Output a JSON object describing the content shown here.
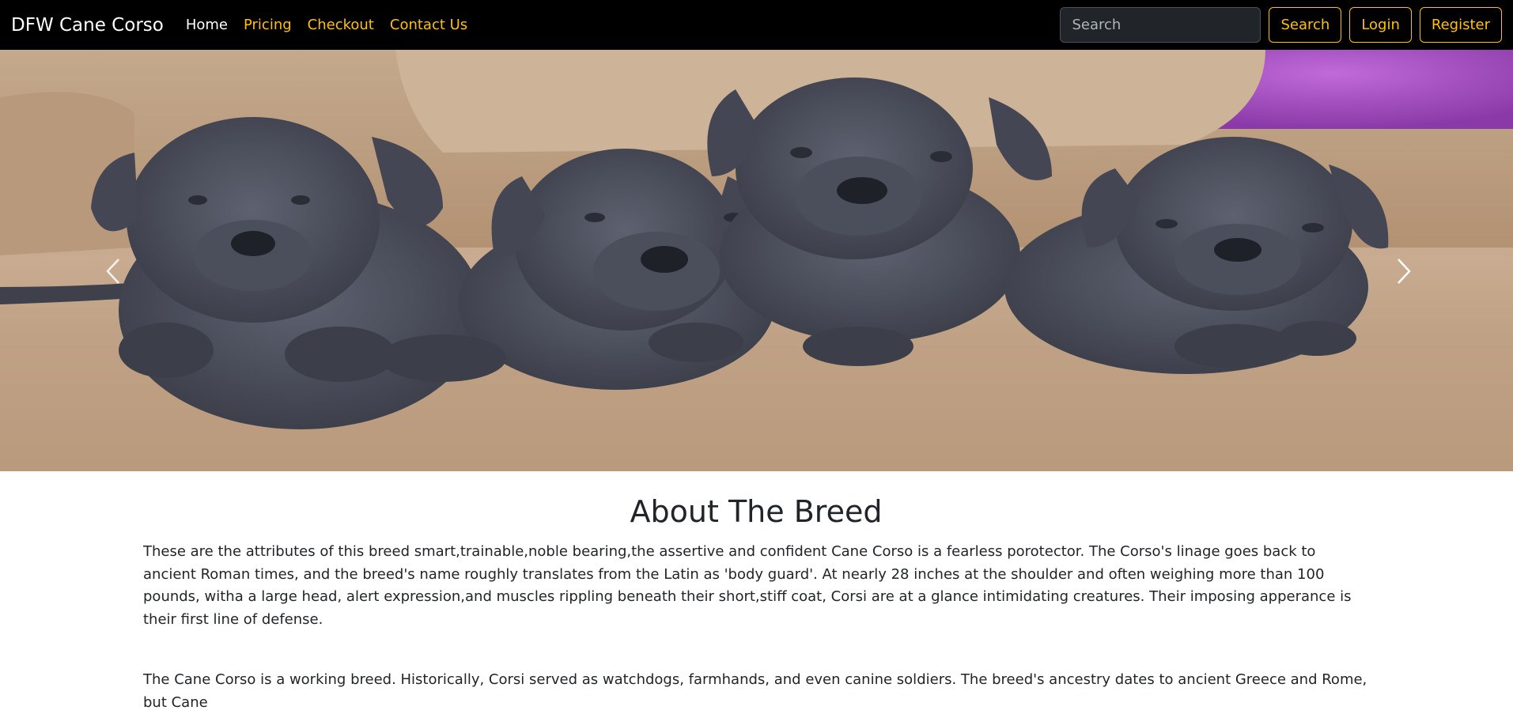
{
  "navbar": {
    "brand": "DFW Cane Corso",
    "links": [
      {
        "label": "Home",
        "active": true
      },
      {
        "label": "Pricing",
        "active": false
      },
      {
        "label": "Checkout",
        "active": false
      },
      {
        "label": "Contact Us",
        "active": false
      }
    ],
    "search": {
      "placeholder": "Search",
      "value": ""
    },
    "search_button": "Search",
    "login_button": "Login",
    "register_button": "Register"
  },
  "carousel": {
    "prev_icon": "chevron-left-icon",
    "next_icon": "chevron-right-icon"
  },
  "about": {
    "title": "About The Breed",
    "paragraph1": "These are the attributes of this breed smart,trainable,noble bearing,the assertive and confident Cane Corso is a fearless porotector. The Corso's linage goes back to ancient Roman times, and the breed's name roughly translates from the Latin as 'body guard'. At nearly 28 inches at the shoulder and often weighing more than 100 pounds, witha a large head, alert expression,and muscles rippling beneath their short,stiff coat, Corsi are at a glance intimidating creatures. Their imposing apperance is their first line of defense.",
    "paragraph2": "The Cane Corso is a working breed. Historically, Corsi served as watchdogs, farmhands, and even canine soldiers. The breed's ancestry dates to ancient Greece and Rome, but Cane"
  },
  "colors": {
    "navbar_bg": "#000000",
    "accent": "#ffc107",
    "text": "#212529"
  }
}
